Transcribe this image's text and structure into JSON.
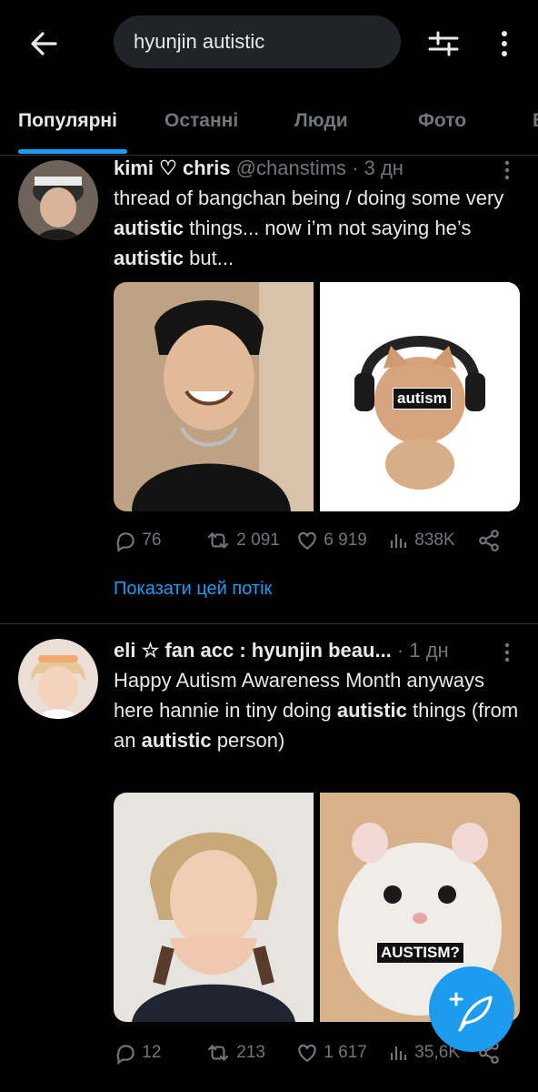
{
  "search": {
    "query": "hyunjin autistic"
  },
  "tabs": [
    {
      "label": "Популярні",
      "active": true
    },
    {
      "label": "Останні"
    },
    {
      "label": "Люди"
    },
    {
      "label": "Фото"
    },
    {
      "label": "В"
    }
  ],
  "tweets": [
    {
      "name": "kimi ♡ chris",
      "handle": "@chanstims",
      "time": "· 3 дн",
      "text_parts": [
        "thread of bangchan being / doing some very ",
        "autistic",
        " things... now i’m not saying he’s ",
        "autistic",
        " but..."
      ],
      "media": [
        {
          "kind": "photo",
          "description_tag": ""
        },
        {
          "kind": "photo",
          "overlay_text": "autism"
        }
      ],
      "stats": {
        "replies": "76",
        "retweets": "2 091",
        "likes": "6 919",
        "views": "838K"
      },
      "thread_link": "Показати цей потік"
    },
    {
      "name": "eli ☆ fan acc : hyunjin beau...",
      "handle": "",
      "time": "· 1 дн",
      "text_parts": [
        "Happy Autism Awareness Month anyways here hannie in tiny doing ",
        "autistic",
        " things (from an ",
        "autistic",
        " person)"
      ],
      "media": [
        {
          "kind": "photo"
        },
        {
          "kind": "photo",
          "overlay_text": "AUSTISM?"
        }
      ],
      "stats": {
        "replies": "12",
        "retweets": "213",
        "likes": "1 617",
        "views": "35,6K"
      }
    }
  ],
  "colors": {
    "accent": "#1d9bf0",
    "background": "#000000",
    "muted": "#71767b",
    "text": "#e7e9ea",
    "divider": "#2f3336"
  },
  "icons": [
    "back-arrow-icon",
    "filter-sliders-icon",
    "more-vertical-icon",
    "reply-icon",
    "retweet-icon",
    "like-icon",
    "views-icon",
    "share-icon",
    "compose-icon"
  ]
}
